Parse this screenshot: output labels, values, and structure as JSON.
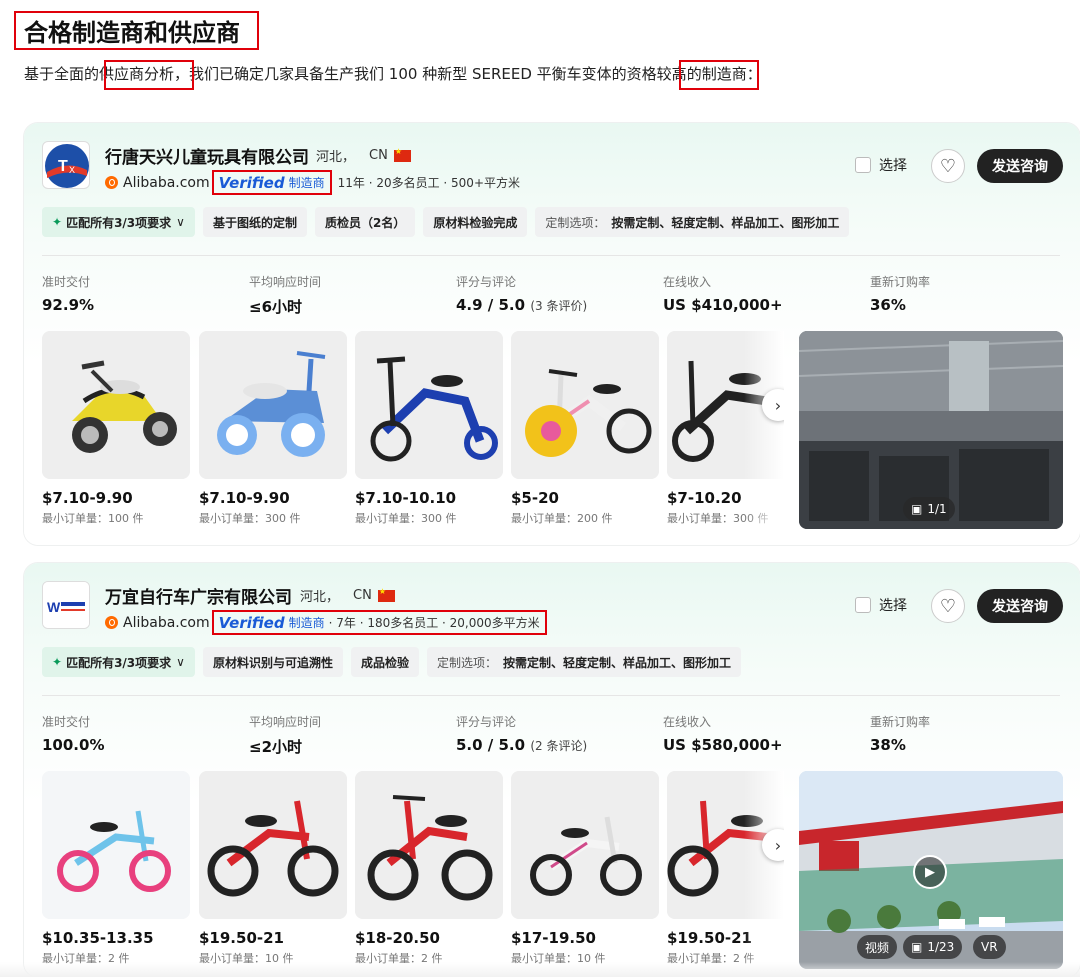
{
  "header": {
    "title": "合格制造商和供应商",
    "intro_parts": [
      "基于全面的",
      "供应商分析",
      "，我们已确定几家具备生产我们 100 种新型 SEREED 平衡车变体的",
      "资格较高",
      "的制造商："
    ]
  },
  "common": {
    "verified_word": "Verified",
    "verified_mfr": "制造商",
    "alibaba": "Alibaba.com",
    "select_label": "选择",
    "inquiry_label": "发送咨询",
    "moq_prefix": "最小订单量：",
    "stat_labels": [
      "准时交付",
      "平均响应时间",
      "评分与评论",
      "在线收入",
      "重新订购率"
    ]
  },
  "suppliers": [
    {
      "name": "行唐天兴儿童玩具有限公司",
      "location": "河北，",
      "country": "CN",
      "meta": "11年 · 20多名员工 · 500+平方米",
      "tags": {
        "match": "匹配所有3/3项要求",
        "t1": "基于图纸的定制",
        "t2": "质检员（2名）",
        "t3": "原材料检验完成",
        "custom_label": "定制选项：",
        "custom_value": "按需定制、轻度定制、样品加工、图形加工"
      },
      "stats": {
        "on_time": "92.9%",
        "response": "≤6小时",
        "rating": "4.9 / 5.0",
        "reviews": "(3 条评价)",
        "revenue": "US $410,000+",
        "reorder": "36%"
      },
      "products": [
        {
          "price": "$7.10-9.90",
          "moq": "最小订单量：100 件"
        },
        {
          "price": "$7.10-9.90",
          "moq": "最小订单量：300 件"
        },
        {
          "price": "$7.10-10.10",
          "moq": "最小订单量：300 件"
        },
        {
          "price": "$5-20",
          "moq": "最小订单量：200 件"
        },
        {
          "price": "$7-10.20",
          "moq": "最小订单量：300 件"
        }
      ],
      "media": {
        "photos": "1/1"
      }
    },
    {
      "name": "万宜自行车广宗有限公司",
      "location": "河北，",
      "country": "CN",
      "meta": "· 7年 · 180多名员工 · 20,000多平方米",
      "tags": {
        "match": "匹配所有3/3项要求",
        "t1": "原材料识别与可追溯性",
        "t2": "成品检验",
        "custom_label": "定制选项：",
        "custom_value": "按需定制、轻度定制、样品加工、图形加工"
      },
      "stats": {
        "on_time": "100.0%",
        "response": "≤2小时",
        "rating": "5.0 / 5.0",
        "reviews": "(2 条评论)",
        "revenue": "US $580,000+",
        "reorder": "38%"
      },
      "products": [
        {
          "price": "$10.35-13.35",
          "moq": "最小订单量：2 件"
        },
        {
          "price": "$19.50-21",
          "moq": "最小订单量：10 件"
        },
        {
          "price": "$18-20.50",
          "moq": "最小订单量：2 件"
        },
        {
          "price": "$17-19.50",
          "moq": "最小订单量：10 件"
        },
        {
          "price": "$19.50-21",
          "moq": "最小订单量：2 件"
        }
      ],
      "media": {
        "video": "视频",
        "photos": "1/23",
        "vr": "VR"
      }
    }
  ],
  "colors": {
    "highlight_red": "#e0000a",
    "verified_blue": "#1a5bd6",
    "dark_button": "#222222",
    "accent_green": "#0a9a5a"
  }
}
